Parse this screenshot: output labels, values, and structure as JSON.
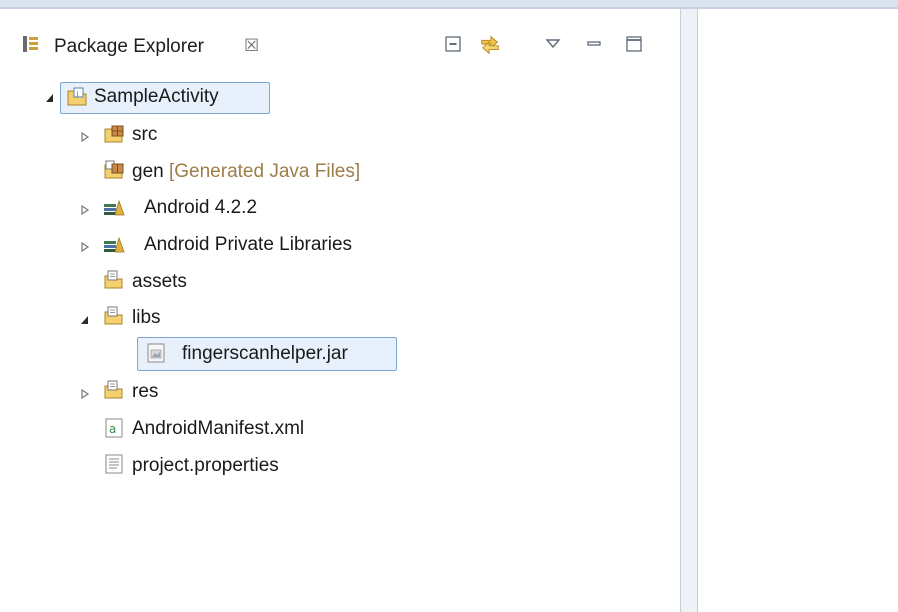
{
  "view": {
    "title": "Package Explorer",
    "close_glyph": "☒"
  },
  "toolbar": {
    "collapse_all_icon": "collapse-all-icon",
    "link_with_editor_icon": "link-with-editor-icon",
    "view_menu_icon": "view-menu-icon",
    "minimize_icon": "minimize-icon",
    "maximize_icon": "maximize-icon"
  },
  "tree": {
    "project": {
      "label": "SampleActivity",
      "expanded": true
    },
    "src": {
      "label": "src"
    },
    "gen": {
      "label": "gen",
      "decoration": "[Generated Java Files]"
    },
    "android": {
      "label": "Android 4.2.2"
    },
    "private_libs": {
      "label": "Android Private Libraries"
    },
    "assets": {
      "label": "assets"
    },
    "libs": {
      "label": "libs",
      "expanded": true
    },
    "jar": {
      "label": "fingerscanhelper.jar",
      "selected": true
    },
    "res": {
      "label": "res"
    },
    "manifest": {
      "label": "AndroidManifest.xml"
    },
    "properties": {
      "label": "project.properties"
    }
  },
  "colors": {
    "selection_border": "#7ba7d9",
    "selection_fill": "#e8f1fb",
    "decoration_text": "#9c7e48",
    "folder": "#f2c744"
  }
}
